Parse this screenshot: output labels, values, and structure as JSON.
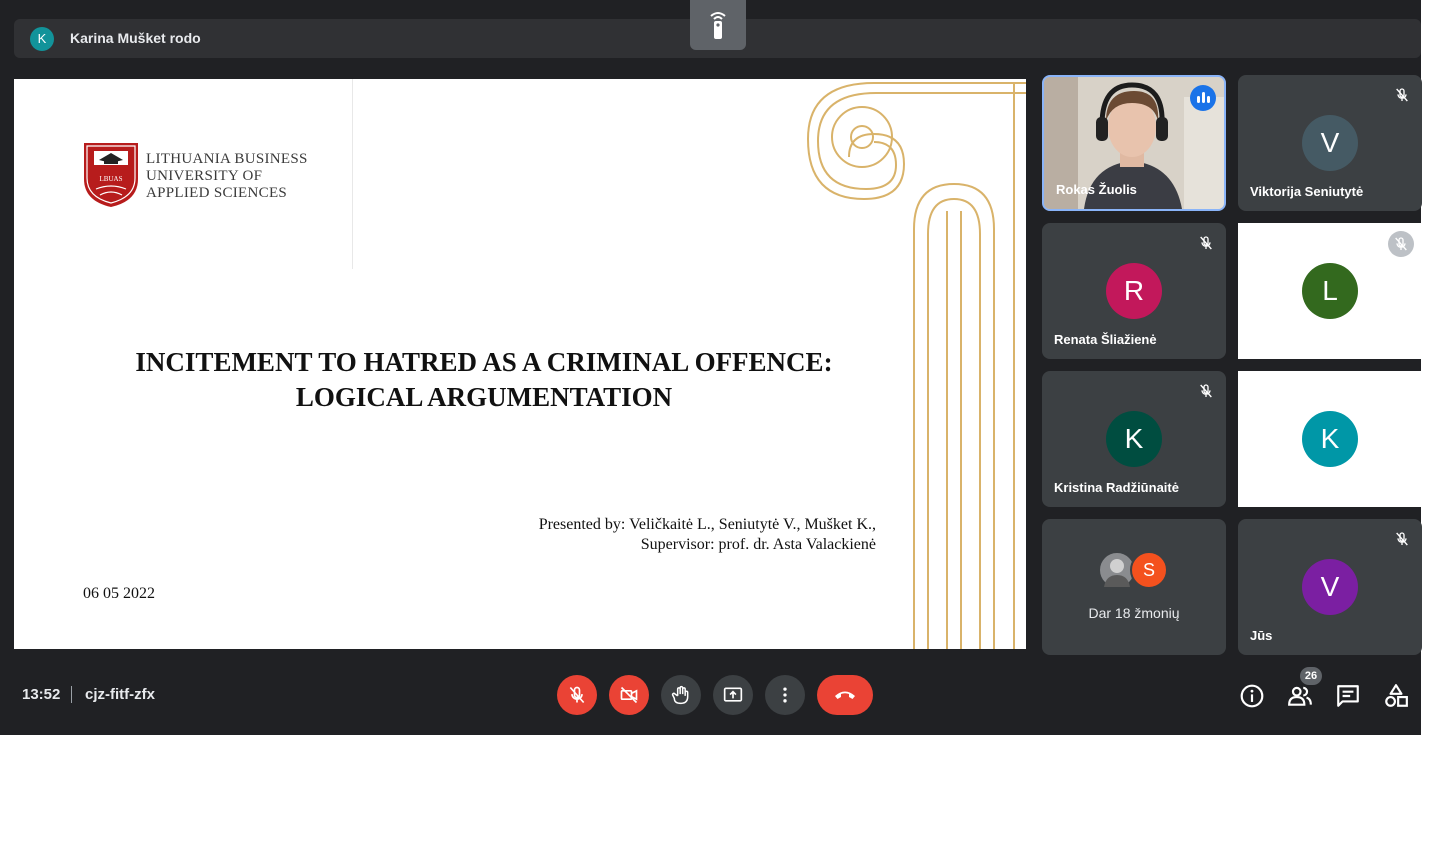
{
  "presenter": {
    "initial": "K",
    "text": "Karina Mušket rodo"
  },
  "slide": {
    "logo_mark": "LBUAS",
    "institution_lines": [
      "LITHUANIA BUSINESS",
      "UNIVERSITY OF",
      "APPLIED SCIENCES"
    ],
    "title_lines": [
      "INCITEMENT TO HATRED AS A CRIMINAL OFFENCE:",
      "LOGICAL ARGUMENTATION"
    ],
    "presented_by": "Presented by: Veličkaitė L., Seniutytė V., Mušket K.,",
    "supervisor": "Supervisor: prof. dr. Asta Valackienė",
    "date": "06 05 2022"
  },
  "participants": [
    {
      "id": "rokas",
      "name": "Rokas Žuolis",
      "speaking": true
    },
    {
      "id": "viktorija",
      "name": "Viktorija Seniutytė",
      "initial": "V",
      "color": "#455a64",
      "muted": true
    },
    {
      "id": "renata",
      "name": "Renata Šliažienė",
      "initial": "R",
      "color": "#c2185b",
      "muted": true
    },
    {
      "id": "l",
      "name": "",
      "initial": "L",
      "color": "#33691e",
      "muted": true
    },
    {
      "id": "kristina",
      "name": "Kristina Radžiūnaitė",
      "initial": "K",
      "color": "#004d40",
      "muted": true
    },
    {
      "id": "k2",
      "name": "",
      "initial": "K",
      "color": "#0097a7",
      "muted": false
    },
    {
      "id": "self",
      "name": "Jūs",
      "initial": "V",
      "color": "#7b1fa2",
      "muted": true
    }
  ],
  "more_participants": {
    "initial": "S",
    "color": "#f4511e",
    "text": "Dar 18 žmonių"
  },
  "footer": {
    "time": "13:52",
    "meeting_code": "cjz-fitf-zfx",
    "people_count": "26"
  },
  "colors": {
    "background": "#202124",
    "tile": "#3c4043",
    "danger": "#ea4335",
    "accent": "#1a73e8",
    "ornament": "#d9b36a",
    "logo_red": "#b71c1c"
  },
  "icons": [
    "mic-off-icon",
    "camera-off-icon",
    "hand-icon",
    "present-icon",
    "more-vert-icon",
    "call-end-icon",
    "info-icon",
    "people-icon",
    "chat-icon",
    "activities-icon",
    "remote-icon",
    "speaking-icon"
  ]
}
